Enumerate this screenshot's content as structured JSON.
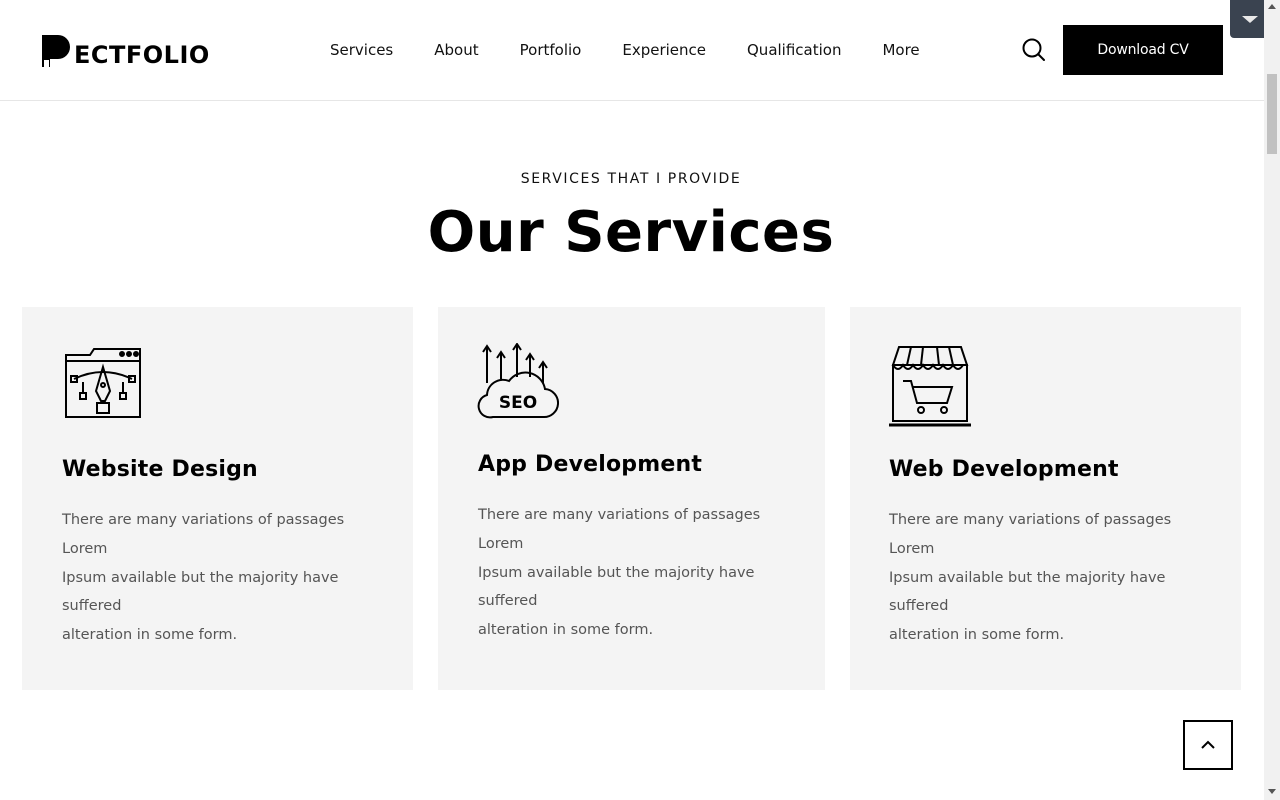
{
  "brand": {
    "logo_text": "ECTFOLIO"
  },
  "nav": {
    "items": [
      "Services",
      "About",
      "Portfolio",
      "Experience",
      "Qualification",
      "More"
    ]
  },
  "header": {
    "cv_button": "Download CV",
    "search_icon": "search-icon"
  },
  "section": {
    "eyebrow": "SERVICES THAT I PROVIDE",
    "title": "Our Services"
  },
  "cards": [
    {
      "icon": "design-pen-tool-icon",
      "title": "Website Design",
      "desc": [
        "There are many variations of passages",
        "Lorem",
        "Ipsum available but the majority have",
        "suffered",
        "alteration in some form."
      ]
    },
    {
      "icon": "seo-cloud-icon",
      "title": "App Development",
      "desc": [
        "There are many variations of passages",
        "Lorem",
        "Ipsum available but the majority have",
        "suffered",
        "alteration in some form."
      ]
    },
    {
      "icon": "shop-cart-icon",
      "title": "Web Development",
      "desc": [
        "There are many variations of passages",
        "Lorem",
        "Ipsum available but the majority have",
        "suffered",
        "alteration in some form."
      ]
    }
  ],
  "colors": {
    "primary": "#000000",
    "card_bg": "#f4f4f4",
    "text_muted": "#555555"
  }
}
